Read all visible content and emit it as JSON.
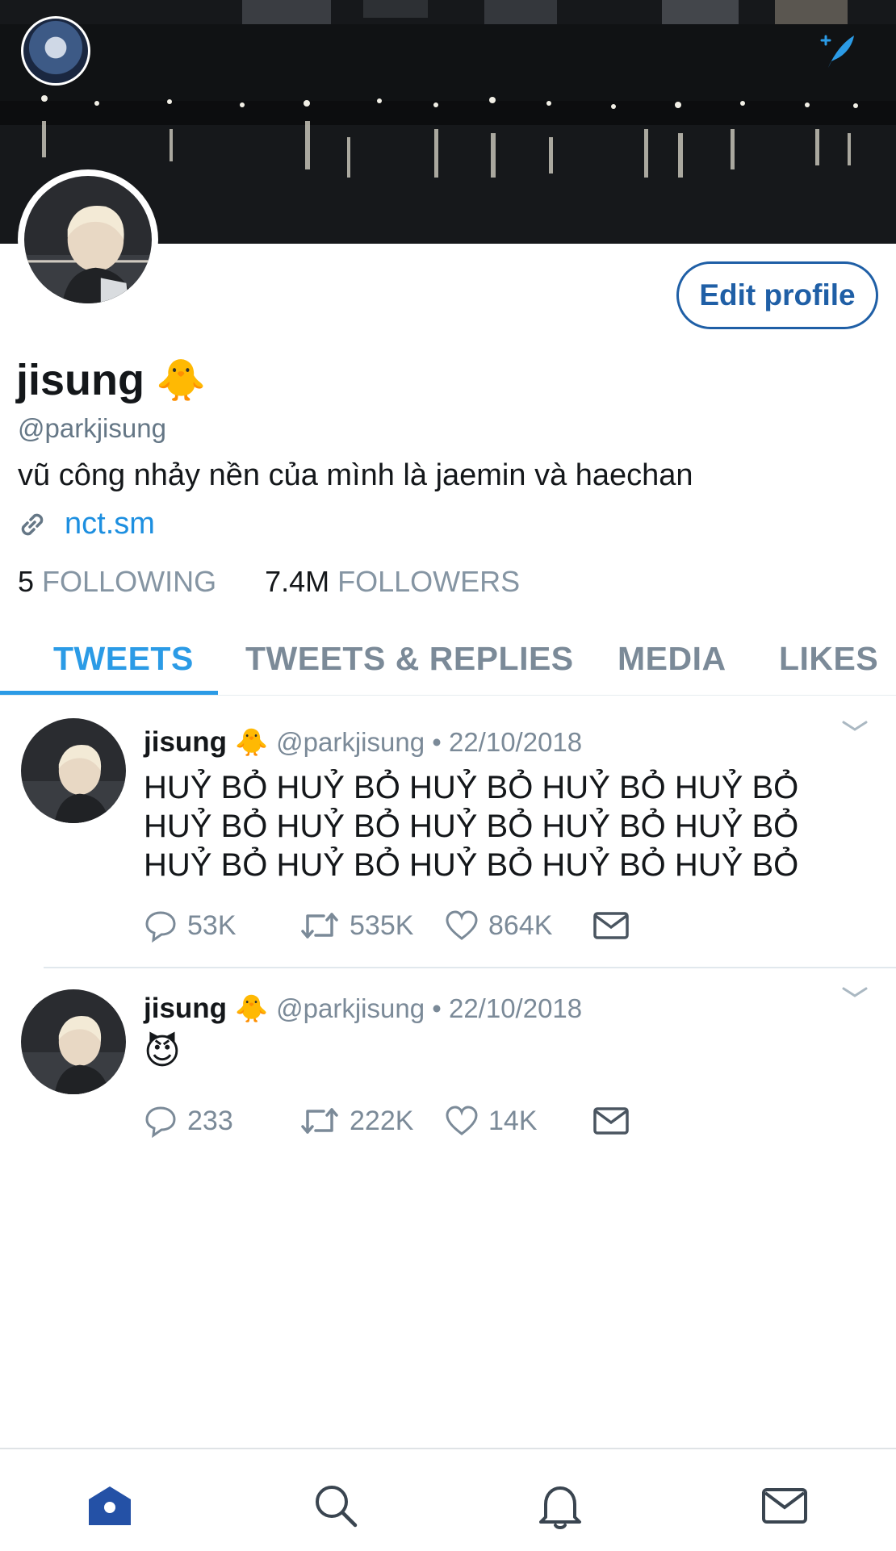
{
  "profile": {
    "display_name": "jisung",
    "name_emoji": "🐥",
    "handle": "@parkjisung",
    "bio": "vũ công nhảy nền của mình là jaemin và haechan",
    "link": "nct.sm",
    "following_count": "5",
    "following_label": "FOLLOWING",
    "followers_count": "7.4M",
    "followers_label": "FOLLOWERS",
    "edit_label": "Edit profile"
  },
  "tabs": [
    {
      "label": "TWEETS",
      "active": true
    },
    {
      "label": "TWEETS & REPLIES",
      "active": false
    },
    {
      "label": "MEDIA",
      "active": false
    },
    {
      "label": "LIKES",
      "active": false
    }
  ],
  "tweets": [
    {
      "name": "jisung",
      "emoji": "🐥",
      "meta": "@parkjisung • 22/10/2018",
      "text_lines": [
        "HUỶ BỎ HUỶ BỎ HUỶ BỎ HUỶ BỎ HUỶ BỎ",
        "HUỶ BỎ HUỶ BỎ HUỶ BỎ HUỶ BỎ HUỶ BỎ",
        "HUỶ BỎ HUỶ BỎ HUỶ BỎ HUỶ BỎ HUỶ BỎ"
      ],
      "replies": "53K",
      "retweets": "535K",
      "likes": "864K"
    },
    {
      "name": "jisung",
      "emoji": "🐥",
      "meta": "@parkjisung • 22/10/2018",
      "text": "😈",
      "replies": "233",
      "retweets": "222K",
      "likes": "14K"
    }
  ],
  "colors": {
    "accent": "#2b9be6",
    "edit_border": "#1f5fa6",
    "muted": "#7b8a98",
    "nav_active": "#2451a6",
    "nav_inactive": "#3a4550"
  },
  "icons": [
    "compose-icon",
    "link-icon",
    "chevron-down-icon",
    "reply-icon",
    "retweet-icon",
    "like-icon",
    "dm-icon",
    "home-icon",
    "search-icon",
    "notifications-icon",
    "messages-icon"
  ]
}
